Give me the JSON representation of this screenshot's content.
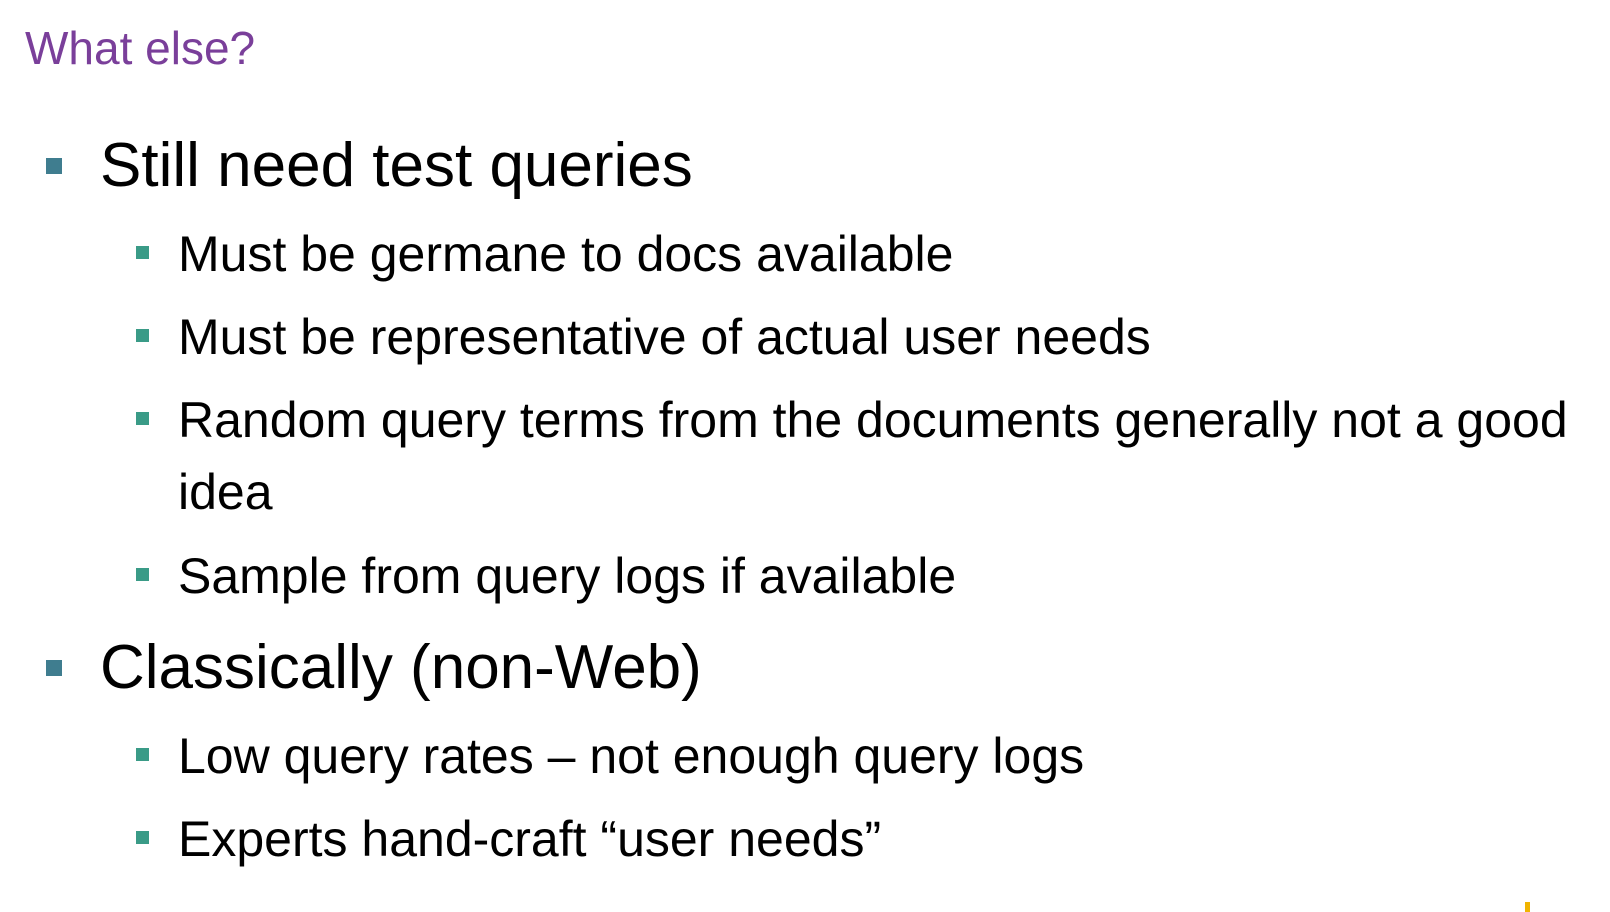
{
  "slide": {
    "title": "What else?",
    "bullets": [
      {
        "text": "Still need test queries",
        "level": 1
      },
      {
        "text": "Must be germane to docs available",
        "level": 2
      },
      {
        "text": "Must be representative of actual user needs",
        "level": 2
      },
      {
        "text": "Random query terms from the documents generally not a good idea",
        "level": 2
      },
      {
        "text": "Sample from query logs if available",
        "level": 2
      },
      {
        "text": "Classically (non-Web)",
        "level": 1
      },
      {
        "text": "Low query rates – not enough query logs",
        "level": 2
      },
      {
        "text": "Experts hand-craft “user needs”",
        "level": 2
      }
    ]
  },
  "colors": {
    "title": "#7a3f9a",
    "level1_marker": "#3f7d8f",
    "level2_marker": "#3a9b87",
    "corner_accent": "#f0b400"
  }
}
